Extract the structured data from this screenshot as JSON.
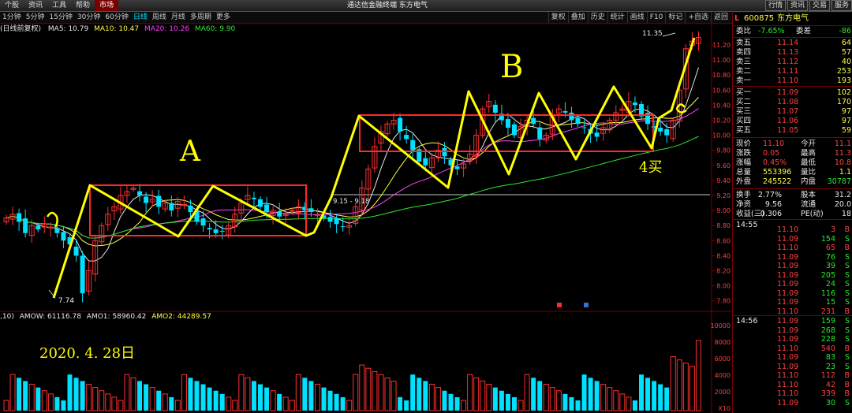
{
  "menu": {
    "items": [
      "个股",
      "资讯",
      "工具",
      "帮助",
      "市场"
    ],
    "active_index": 4,
    "title": "通达信金融终端  东方电气",
    "window_buttons": [
      "行情",
      "资讯",
      "交易",
      "服务"
    ]
  },
  "periods": {
    "items": [
      "1分钟",
      "5分钟",
      "15分钟",
      "30分钟",
      "60分钟",
      "日线",
      "周线",
      "月线",
      "多周期",
      "更多"
    ],
    "active_index": 5
  },
  "tools": [
    "复权",
    "叠加",
    "历史",
    "统计",
    "画线",
    "F10",
    "标记",
    "+自选",
    "返回"
  ],
  "indicator_line": {
    "prefix": "(日线前复权)",
    "ma5": "MA5: 10.79",
    "ma10": "MA10: 10.47",
    "ma20": "MA20: 10.26",
    "ma60": "MA60: 9.90"
  },
  "vol_line": {
    "prefix": ",10)",
    "amow": "AMOW: 61116.78",
    "amo1": "AMO1: 58960.42",
    "amo2": "AMO2: 44289.57"
  },
  "annotations": {
    "high_label": "11.35",
    "low_label": "7.74",
    "range_label": "9.15 - 9.18",
    "label_a": "A",
    "label_b": "B",
    "label_c": "c",
    "label_a_left": "a",
    "buy_label": "4买",
    "date_label": "2020. 4. 28日"
  },
  "price_axis": [
    "11.20",
    "11.00",
    "10.80",
    "10.60",
    "10.40",
    "10.20",
    "10.00",
    "9.80",
    "9.60",
    "9.40",
    "9.20",
    "9.00",
    "8.80",
    "8.60",
    "8.40",
    "8.20",
    "8.00",
    "7.80"
  ],
  "volume_axis": [
    "10000",
    "8000",
    "6000",
    "4000",
    "2000",
    "X10"
  ],
  "chart_data": {
    "type": "candlestick",
    "ylim": [
      7.7,
      11.4
    ],
    "close": [
      8.9,
      8.95,
      8.85,
      8.7,
      8.8,
      8.75,
      8.82,
      8.78,
      8.7,
      8.6,
      8.55,
      8.4,
      7.9,
      8.2,
      8.6,
      8.8,
      8.95,
      9.05,
      9.2,
      9.25,
      9.3,
      9.2,
      9.1,
      9.15,
      9.05,
      9.1,
      9.0,
      9.12,
      9.08,
      8.98,
      8.85,
      8.8,
      8.75,
      8.7,
      8.72,
      8.8,
      8.95,
      9.1,
      9.2,
      9.15,
      9.05,
      8.98,
      9.0,
      8.92,
      8.95,
      9.0,
      9.05,
      9.0,
      8.98,
      8.95,
      8.9,
      8.85,
      8.82,
      8.78,
      8.8,
      9.05,
      9.3,
      9.55,
      9.85,
      10.05,
      10.15,
      10.2,
      10.05,
      9.95,
      9.8,
      9.65,
      9.6,
      9.7,
      9.8,
      9.72,
      9.6,
      9.55,
      9.62,
      9.75,
      10.0,
      10.35,
      10.45,
      10.3,
      10.2,
      10.1,
      10.0,
      10.12,
      10.2,
      10.15,
      9.95,
      10.0,
      10.25,
      10.35,
      10.3,
      10.2,
      10.15,
      10.1,
      10.02,
      9.98,
      10.1,
      10.2,
      10.3,
      10.35,
      10.45,
      10.4,
      10.25,
      10.15,
      10.1,
      10.05,
      10.0,
      10.2,
      10.6,
      11.15,
      11.25,
      11.3
    ]
  },
  "quote_panel": {
    "code": "600875",
    "name": "东方电气",
    "weibi_label": "委比",
    "weibi": "-7.65%",
    "weicha_label": "委差",
    "weicha": "-86",
    "asks": [
      {
        "label": "卖五",
        "price": "11.14",
        "vol": "64"
      },
      {
        "label": "卖四",
        "price": "11.13",
        "vol": "57"
      },
      {
        "label": "卖三",
        "price": "11.12",
        "vol": "40"
      },
      {
        "label": "卖二",
        "price": "11.11",
        "vol": "253"
      },
      {
        "label": "卖一",
        "price": "11.10",
        "vol": "193"
      }
    ],
    "bids": [
      {
        "label": "买一",
        "price": "11.09",
        "vol": "102"
      },
      {
        "label": "买二",
        "price": "11.08",
        "vol": "170"
      },
      {
        "label": "买三",
        "price": "11.07",
        "vol": "97"
      },
      {
        "label": "买四",
        "price": "11.06",
        "vol": "97"
      },
      {
        "label": "买五",
        "price": "11.05",
        "vol": "59"
      }
    ],
    "stats": [
      {
        "l1": "现价",
        "v1": "11.10",
        "l2": "今开",
        "v2": "11.1"
      },
      {
        "l1": "涨跌",
        "v1": "0.05",
        "l2": "最高",
        "v2": "11.3"
      },
      {
        "l1": "涨幅",
        "v1": "0.45%",
        "l2": "最低",
        "v2": "10.8"
      },
      {
        "l1": "总量",
        "v1": "553396",
        "l2": "量比",
        "v2": "1.1"
      },
      {
        "l1": "外盘",
        "v1": "245522",
        "l2": "内盘",
        "v2": "30787"
      }
    ],
    "stats2": [
      {
        "l1": "换手",
        "v1": "2.77%",
        "l2": "股本",
        "v2": "31.2"
      },
      {
        "l1": "净资",
        "v1": "9.56",
        "l2": "流通",
        "v2": "20.0"
      },
      {
        "l1": "收益(三)",
        "v1": "0.306",
        "l2": "PE(动)",
        "v2": "18"
      }
    ],
    "ticks_1455": {
      "time": "14:55",
      "rows": [
        {
          "p": "11.10",
          "v": "3",
          "t": "B"
        },
        {
          "p": "11.09",
          "v": "154",
          "t": "S"
        },
        {
          "p": "11.10",
          "v": "65",
          "t": "B"
        },
        {
          "p": "11.09",
          "v": "76",
          "t": "S"
        },
        {
          "p": "11.09",
          "v": "39",
          "t": "S"
        },
        {
          "p": "11.09",
          "v": "205",
          "t": "S"
        },
        {
          "p": "11.09",
          "v": "24",
          "t": "S"
        },
        {
          "p": "11.09",
          "v": "116",
          "t": "S"
        },
        {
          "p": "11.09",
          "v": "15",
          "t": "S"
        },
        {
          "p": "11.10",
          "v": "231",
          "t": "B"
        }
      ]
    },
    "ticks_1456": {
      "time": "14:56",
      "rows": [
        {
          "p": "11.09",
          "v": "159",
          "t": "S"
        },
        {
          "p": "11.09",
          "v": "268",
          "t": "S"
        },
        {
          "p": "11.09",
          "v": "228",
          "t": "S"
        },
        {
          "p": "11.10",
          "v": "540",
          "t": "B"
        },
        {
          "p": "11.09",
          "v": "83",
          "t": "S"
        },
        {
          "p": "11.09",
          "v": "23",
          "t": "S"
        },
        {
          "p": "11.10",
          "v": "112",
          "t": "B"
        },
        {
          "p": "11.10",
          "v": "42",
          "t": "B"
        },
        {
          "p": "11.10",
          "v": "339",
          "t": "B"
        },
        {
          "p": "11.09",
          "v": "30",
          "t": "S"
        }
      ]
    }
  }
}
